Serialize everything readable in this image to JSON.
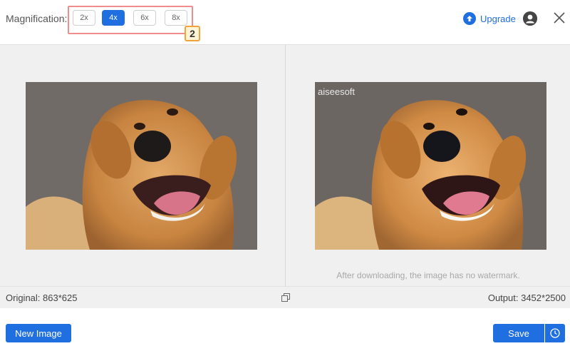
{
  "toolbar": {
    "magnification_label": "Magnification:",
    "options": [
      "2x",
      "4x",
      "6x",
      "8x"
    ],
    "selected": "4x",
    "step_badge": "2",
    "upgrade_label": "Upgrade",
    "upgrade_icon": "upload-arrow-icon",
    "account_icon": "user-icon",
    "close_icon": "close-icon"
  },
  "preview": {
    "left_image": "dog-photo-original",
    "right_image": "dog-photo-upscaled",
    "watermark_text": "aiseesoft",
    "notice": "After downloading, the image has no watermark."
  },
  "info": {
    "original": "Original: 863*625",
    "output": "Output: 3452*2500",
    "compare_icon": "copy-icon"
  },
  "footer": {
    "new_image_label": "New Image",
    "save_label": "Save",
    "history_icon": "clock-icon"
  },
  "colors": {
    "accent": "#1f6fe0",
    "highlight_border": "#ef8c8c",
    "badge_border": "#f0a23c"
  }
}
